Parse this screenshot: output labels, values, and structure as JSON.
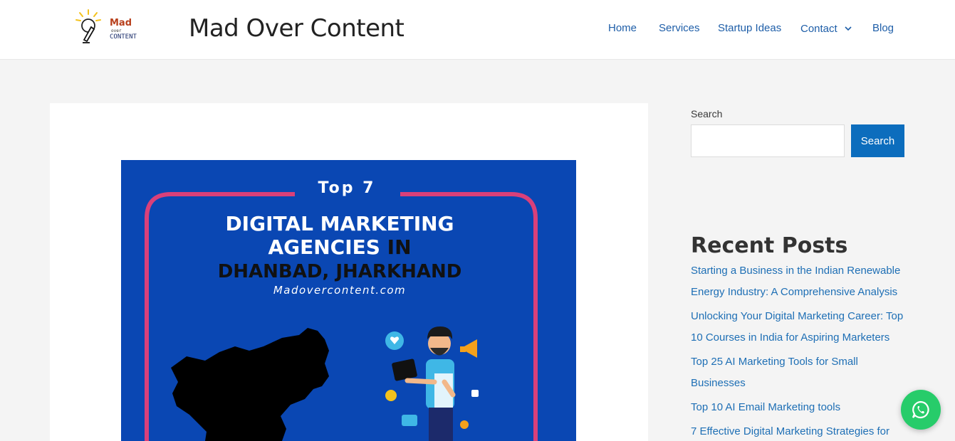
{
  "header": {
    "site_title": "Mad Over Content",
    "logo_text_top": "Mad",
    "logo_text_mid": "over",
    "logo_text_bottom": "CONTENT"
  },
  "nav": {
    "items": [
      {
        "label": "Home"
      },
      {
        "label": "Services"
      },
      {
        "label": "Startup Ideas"
      },
      {
        "label": "Contact"
      },
      {
        "label": "Blog"
      }
    ]
  },
  "featured_image": {
    "kicker": "Top 7",
    "line1": "DIGITAL MARKETING",
    "line2_a": "AGENCIES",
    "line2_b": " IN",
    "line3": "DHANBAD, JHARKHAND",
    "site": "Madovercontent.com",
    "colors": {
      "background": "#0a47b3",
      "border": "#d9407a",
      "dark_text": "#111111",
      "white": "#ffffff"
    }
  },
  "search": {
    "label": "Search",
    "placeholder": "",
    "button_label": "Search"
  },
  "recent_posts": {
    "title": "Recent Posts",
    "items": [
      {
        "label": "Starting a Business in the Indian Renewable Energy Industry: A Comprehensive Analysis"
      },
      {
        "label": "Unlocking Your Digital Marketing Career: Top 10 Courses in India for Aspiring Marketers"
      },
      {
        "label": "Top 25 AI Marketing Tools for Small Businesses"
      },
      {
        "label": "Top 10 AI Email Marketing tools"
      },
      {
        "label": "7 Effective Digital Marketing Strategies for"
      }
    ]
  },
  "colors": {
    "link": "#1e6fb5",
    "button": "#0c6dbd",
    "whatsapp": "#27cc6a",
    "page_bg": "#f4f4f4"
  },
  "icons": {
    "contact_dropdown": "chevron-down-icon",
    "whatsapp": "whatsapp-icon"
  }
}
